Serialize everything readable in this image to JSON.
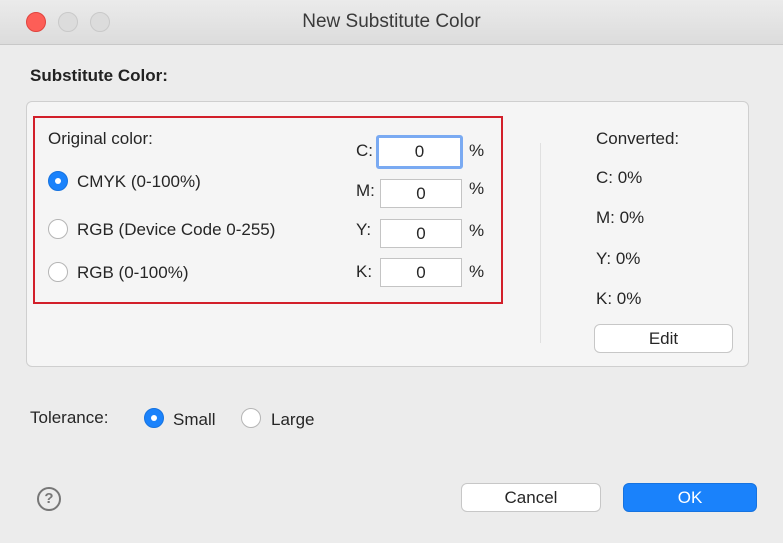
{
  "window": {
    "title": "New Substitute Color"
  },
  "section_title": "Substitute Color:",
  "original": {
    "label": "Original color:",
    "options": [
      {
        "label": "CMYK (0-100%)",
        "selected": true
      },
      {
        "label": "RGB (Device Code 0-255)",
        "selected": false
      },
      {
        "label": "RGB (0-100%)",
        "selected": false
      }
    ],
    "channels": [
      {
        "label": "C:",
        "value": "0",
        "unit": "%"
      },
      {
        "label": "M:",
        "value": "0",
        "unit": "%"
      },
      {
        "label": "Y:",
        "value": "0",
        "unit": "%"
      },
      {
        "label": "K:",
        "value": "0",
        "unit": "%"
      }
    ]
  },
  "converted": {
    "label": "Converted:",
    "values": [
      "C: 0%",
      "M: 0%",
      "Y: 0%",
      "K: 0%"
    ],
    "edit_label": "Edit"
  },
  "tolerance": {
    "label": "Tolerance:",
    "options": [
      {
        "label": "Small",
        "selected": true
      },
      {
        "label": "Large",
        "selected": false
      }
    ]
  },
  "help_icon": {
    "glyph": "?"
  },
  "buttons": {
    "cancel": "Cancel",
    "ok": "OK"
  },
  "colors": {
    "accent": "#1a82fb",
    "highlight_border": "#d21f2a",
    "close": "#fd5e57"
  }
}
